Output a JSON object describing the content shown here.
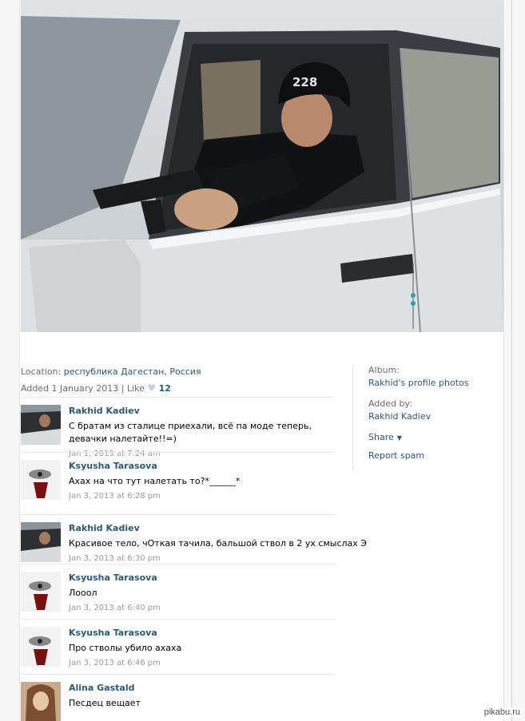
{
  "meta": {
    "location_label": "Location: ",
    "location_value": "республика Дагестан, Россия",
    "added_text": "Added 1 January 2013",
    "separator": "|",
    "like_label": "Like",
    "like_count": "12"
  },
  "sidebar": {
    "album_label": "Album:",
    "album_link": "Rakhid's profile photos",
    "added_by_label": "Added by:",
    "added_by_link": "Rakhid Kadiev",
    "share_label": "Share",
    "report_label": "Report spam"
  },
  "comments": [
    {
      "author": "Rakhid Kadiev",
      "text": "С братам из сталице приехали, всё па моде теперь, девачки налетайте!!=)",
      "date": "Jan 1, 2013 at 7:24 am",
      "avatar": "car"
    },
    {
      "author": "Ksyusha Tarasova",
      "text": "Ахах на что тут налетать то?*______*",
      "date": "Jan 3, 2013 at 6:28 pm",
      "avatar": "face"
    },
    {
      "author": "Rakhid Kadiev",
      "text": "Красивое тело, чОткая тачила, бальшой ствол в 2 ух смыслах Э",
      "date": "Jan 3, 2013 at 6:30 pm",
      "avatar": "car"
    },
    {
      "author": "Ksyusha Tarasova",
      "text": "Лооол",
      "date": "Jan 3, 2013 at 6:40 pm",
      "avatar": "face"
    },
    {
      "author": "Ksyusha Tarasova",
      "text": "Про стволы убило ахаха",
      "date": "Jan 3, 2013 at 6:46 pm",
      "avatar": "face"
    },
    {
      "author": "Alina Gastald",
      "text": "Песдец вещает",
      "date": "",
      "avatar": "girl"
    }
  ],
  "photo": {
    "cap_text": "228"
  },
  "watermark": "pikabu.ru",
  "colors": {
    "link": "#2b587a",
    "muted": "#6b6b6b",
    "date": "#999999"
  }
}
